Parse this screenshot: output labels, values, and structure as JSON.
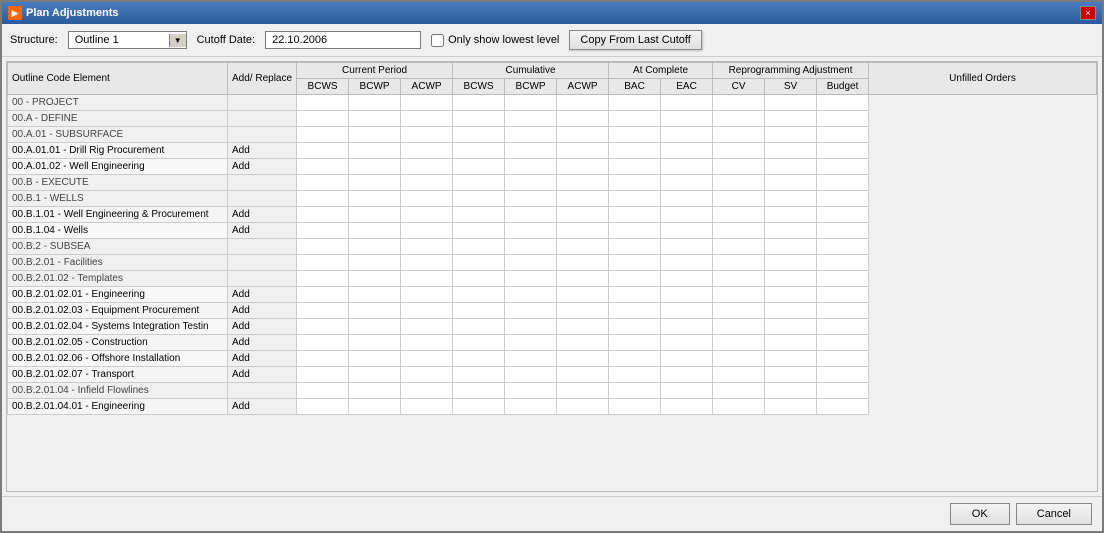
{
  "window": {
    "title": "Plan Adjustments",
    "close_icon": "×"
  },
  "toolbar": {
    "structure_label": "Structure:",
    "structure_value": "Outline 1",
    "cutoff_label": "Cutoff Date:",
    "cutoff_value": "22.10.2006",
    "only_show_lowest_label": "Only show lowest level",
    "copy_button_label": "Copy From Last Cutoff"
  },
  "table": {
    "headers": {
      "outline_code": "Outline Code Element",
      "add_replace": "Add/ Replace",
      "current_period_group": "Current Period",
      "cumulative_group": "Cumulative",
      "at_complete_group": "At Complete",
      "reprogramming_group": "Reprogramming Adjustment",
      "unfilled_orders": "Unfilled Orders",
      "bcws1": "BCWS",
      "bcwp1": "BCWP",
      "acwp1": "ACWP",
      "bcws2": "BCWS",
      "bcwp2": "BCWP",
      "acwp2": "ACWP",
      "bac": "BAC",
      "eac": "EAC",
      "cv": "CV",
      "sv": "SV",
      "budget": "Budget"
    },
    "rows": [
      {
        "label": "00 - PROJECT",
        "add_replace": "",
        "is_header": true
      },
      {
        "label": "00.A - DEFINE",
        "add_replace": "",
        "is_header": true
      },
      {
        "label": "00.A.01 - SUBSURFACE",
        "add_replace": "",
        "is_header": true
      },
      {
        "label": "00.A.01.01 - Drill Rig Procurement",
        "add_replace": "Add",
        "is_header": false
      },
      {
        "label": "00.A.01.02 - Well Engineering",
        "add_replace": "Add",
        "is_header": false
      },
      {
        "label": "00.B - EXECUTE",
        "add_replace": "",
        "is_header": true
      },
      {
        "label": "00.B.1 - WELLS",
        "add_replace": "",
        "is_header": true
      },
      {
        "label": "00.B.1.01 - Well Engineering & Procurement",
        "add_replace": "Add",
        "is_header": false
      },
      {
        "label": "00.B.1.04 - Wells",
        "add_replace": "Add",
        "is_header": false
      },
      {
        "label": "00.B.2 - SUBSEA",
        "add_replace": "",
        "is_header": true
      },
      {
        "label": "00.B.2.01 - Facilities",
        "add_replace": "",
        "is_header": true
      },
      {
        "label": "00.B.2.01.02 - Templates",
        "add_replace": "",
        "is_header": true
      },
      {
        "label": "00.B.2.01.02.01 - Engineering",
        "add_replace": "Add",
        "is_header": false
      },
      {
        "label": "00.B.2.01.02.03 - Equipment Procurement",
        "add_replace": "Add",
        "is_header": false
      },
      {
        "label": "00.B.2.01.02.04 - Systems Integration Testin",
        "add_replace": "Add",
        "is_header": false
      },
      {
        "label": "00.B.2.01.02.05 - Construction",
        "add_replace": "Add",
        "is_header": false
      },
      {
        "label": "00.B.2.01.02.06 - Offshore Installation",
        "add_replace": "Add",
        "is_header": false
      },
      {
        "label": "00.B.2.01.02.07 - Transport",
        "add_replace": "Add",
        "is_header": false
      },
      {
        "label": "00.B.2.01.04 - Infield Flowlines",
        "add_replace": "",
        "is_header": true
      },
      {
        "label": "00.B.2.01.04.01 - Engineering",
        "add_replace": "Add",
        "is_header": false
      }
    ]
  },
  "footer": {
    "ok_label": "OK",
    "cancel_label": "Cancel"
  }
}
